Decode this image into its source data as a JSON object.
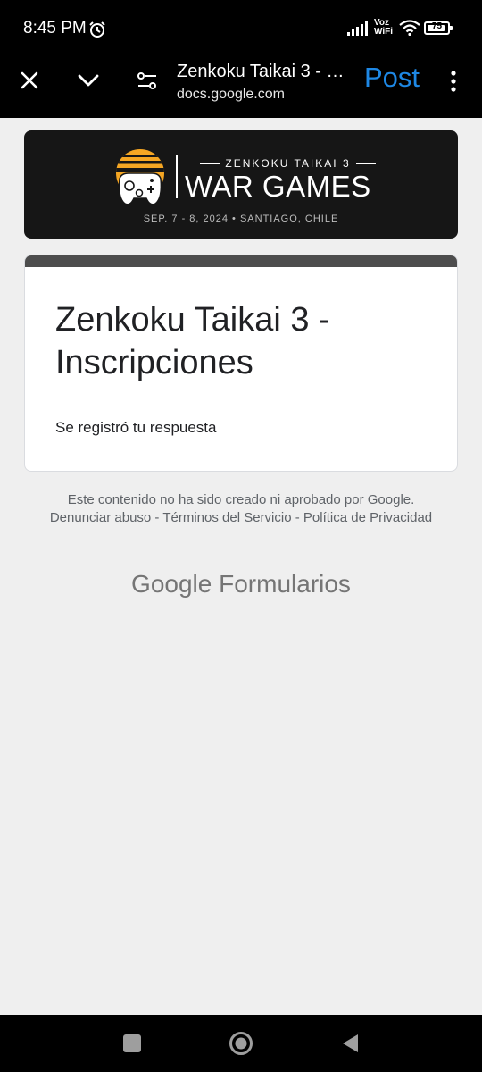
{
  "status_bar": {
    "time": "8:45 PM",
    "voz_line1": "Voz",
    "voz_line2": "WiFi",
    "battery": "75"
  },
  "app_bar": {
    "title": "Zenkoku Taikai 3 - …",
    "url": "docs.google.com",
    "post_label": "Post",
    "accent": "#1e88e5"
  },
  "banner": {
    "subtitle": "ZENKOKU TAIKAI 3",
    "headline": "WAR GAMES",
    "dates": "SEP. 7 - 8, 2024 • SANTIAGO, CHILE",
    "sun_color": "#f5a623"
  },
  "form": {
    "title": "Zenkoku Taikai 3 - Inscripciones",
    "response": "Se registró tu respuesta"
  },
  "footer": {
    "disclaimer": "Este contenido no ha sido creado ni aprobado por Google.",
    "links": {
      "abuse": "Denunciar abuso",
      "terms": "Términos del Servicio",
      "privacy": "Política de Privacidad"
    },
    "separator": " - ",
    "brand_google": "Google",
    "brand_forms": "Formularios"
  },
  "icons": {
    "close": "close-icon",
    "chevron": "chevron-down-icon",
    "settings": "tune-icon",
    "menu": "more-vert-icon"
  }
}
